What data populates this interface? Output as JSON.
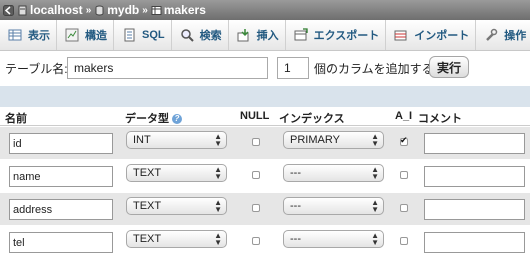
{
  "breadcrumb": [
    {
      "icon": "server-icon",
      "label": "localhost"
    },
    {
      "icon": "database-icon",
      "label": "mydb"
    },
    {
      "icon": "table-icon",
      "label": "makers"
    }
  ],
  "tabs": [
    {
      "key": "browse",
      "label": "表示",
      "icon": "browse-icon"
    },
    {
      "key": "structure",
      "label": "構造",
      "icon": "structure-icon"
    },
    {
      "key": "sql",
      "label": "SQL",
      "icon": "sql-icon"
    },
    {
      "key": "search",
      "label": "検索",
      "icon": "search-icon"
    },
    {
      "key": "insert",
      "label": "挿入",
      "icon": "insert-icon"
    },
    {
      "key": "export",
      "label": "エクスポート",
      "icon": "export-icon"
    },
    {
      "key": "import",
      "label": "インポート",
      "icon": "import-icon"
    },
    {
      "key": "operations",
      "label": "操作",
      "icon": "wrench-icon"
    }
  ],
  "form": {
    "table_name_label": "テーブル名:",
    "table_name_value": "makers",
    "num_columns_value": "1",
    "add_columns_label": "個のカラムを追加する",
    "execute_label": "実行"
  },
  "columns_header": {
    "name": "名前",
    "type": "データ型",
    "null": "NULL",
    "index": "インデックス",
    "ai": "A_I",
    "comment": "コメント"
  },
  "rows": [
    {
      "name": "id",
      "type": "INT",
      "null": false,
      "index": "PRIMARY",
      "ai": true
    },
    {
      "name": "name",
      "type": "TEXT",
      "null": false,
      "index": "---",
      "ai": false
    },
    {
      "name": "address",
      "type": "TEXT",
      "null": false,
      "index": "---",
      "ai": false
    },
    {
      "name": "tel",
      "type": "TEXT",
      "null": false,
      "index": "---",
      "ai": false
    }
  ],
  "colors": {
    "tab_text": "#235a81",
    "band": "#d9e3ec",
    "alt_row": "#e6e6e6"
  }
}
